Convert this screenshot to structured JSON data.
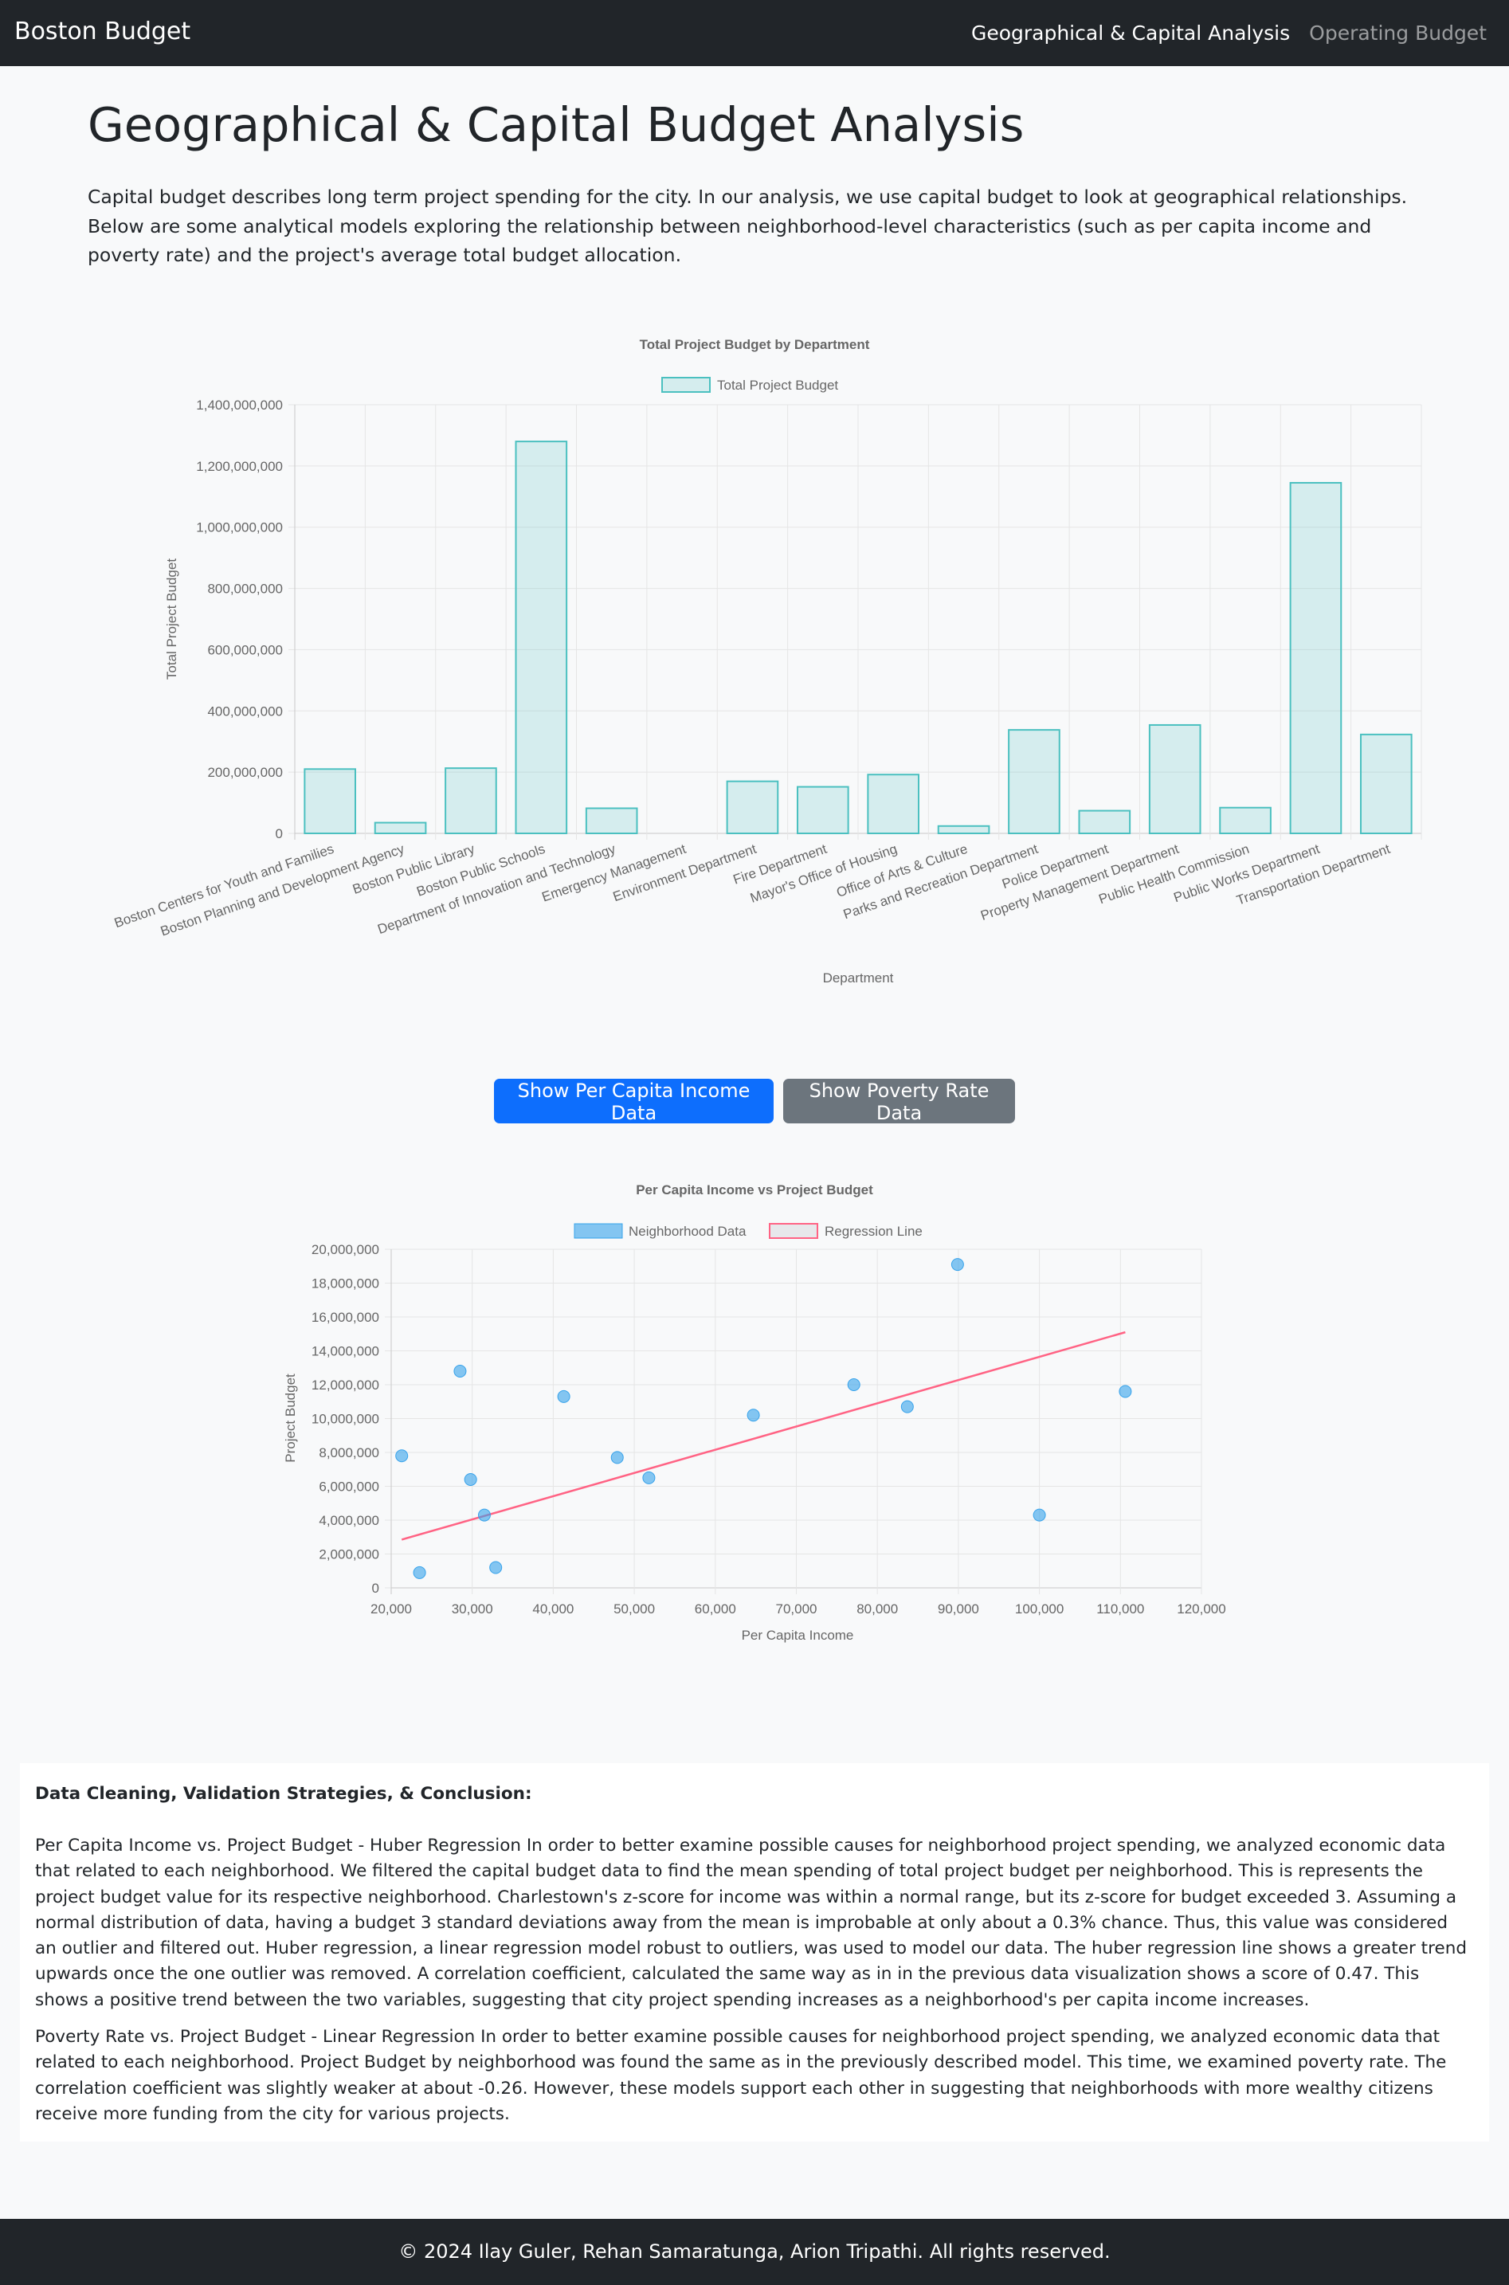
{
  "navbar": {
    "brand": "Boston Budget",
    "links": [
      {
        "label": "Geographical & Capital Analysis",
        "active": true
      },
      {
        "label": "Operating Budget",
        "active": false
      }
    ]
  },
  "page": {
    "title": "Geographical & Capital Budget Analysis",
    "intro": "Capital budget describes long term project spending for the city. In our analysis, we use capital budget to look at geographical relationships. Below are some analytical models exploring the relationship between neighborhood-level characteristics (such as per capita income and poverty rate) and the project's average total budget allocation."
  },
  "buttons": {
    "income": "Show Per Capita Income Data",
    "poverty": "Show Poverty Rate Data"
  },
  "chart_data": [
    {
      "type": "bar",
      "title": "Total Project Budget by Department",
      "xlabel": "Department",
      "ylabel": "Total Project Budget",
      "legend": "Total Project Budget",
      "legend_position": "top",
      "ylim": [
        0,
        1400000000
      ],
      "yticks": [
        "0",
        "200,000,000",
        "400,000,000",
        "600,000,000",
        "800,000,000",
        "1,000,000,000",
        "1,200,000,000",
        "1,400,000,000"
      ],
      "grid": true,
      "colors": {
        "fill": "rgba(75,192,192,0.2)",
        "stroke": "#4bc0c0"
      },
      "categories": [
        "Boston Centers for Youth and Families",
        "Boston Planning and Development Agency",
        "Boston Public Library",
        "Boston Public Schools",
        "Department of Innovation and Technology",
        "Emergency Management",
        "Environment Department",
        "Fire Department",
        "Mayor's Office of Housing",
        "Office of Arts & Culture",
        "Parks and Recreation Department",
        "Police Department",
        "Property Management Department",
        "Public Health Commission",
        "Public Works Department",
        "Transportation Department"
      ],
      "values": [
        210000000,
        35000000,
        213000000,
        1280000000,
        82000000,
        0,
        170000000,
        152000000,
        192000000,
        24000000,
        338000000,
        74000000,
        354000000,
        84000000,
        1145000000,
        323000000
      ]
    },
    {
      "type": "scatter",
      "title": "Per Capita Income vs Project Budget",
      "xlabel": "Per Capita Income",
      "ylabel": "Project Budget",
      "legend_position": "top",
      "xlim": [
        20000,
        120000
      ],
      "ylim": [
        0,
        20000000
      ],
      "xticks": [
        "20,000",
        "30,000",
        "40,000",
        "50,000",
        "60,000",
        "70,000",
        "80,000",
        "90,000",
        "100,000",
        "110,000",
        "120,000"
      ],
      "yticks": [
        "0",
        "2,000,000",
        "4,000,000",
        "6,000,000",
        "8,000,000",
        "10,000,000",
        "12,000,000",
        "14,000,000",
        "16,000,000",
        "18,000,000",
        "20,000,000"
      ],
      "grid": true,
      "series": [
        {
          "name": "Neighborhood Data",
          "color": "#36a2eb",
          "points": [
            [
              21300,
              7800000
            ],
            [
              23500,
              900000
            ],
            [
              28500,
              12800000
            ],
            [
              29800,
              6400000
            ],
            [
              31500,
              4300000
            ],
            [
              32900,
              1200000
            ],
            [
              41300,
              11300000
            ],
            [
              47900,
              7700000
            ],
            [
              51800,
              6500000
            ],
            [
              64700,
              10200000
            ],
            [
              77100,
              12000000
            ],
            [
              83700,
              10700000
            ],
            [
              89900,
              19100000
            ],
            [
              100000,
              4300000
            ],
            [
              110600,
              11600000
            ]
          ]
        },
        {
          "name": "Regression Line",
          "color": "#ff6384",
          "points": [
            [
              21300,
              2850000
            ],
            [
              110600,
              15100000
            ]
          ]
        }
      ]
    }
  ],
  "analysis": {
    "title": "Data Cleaning, Validation Strategies, & Conclusion:",
    "paragraphs": [
      "Per Capita Income vs. Project Budget - Huber Regression In order to better examine possible causes for neighborhood project spending, we analyzed economic data that related to each neighborhood. We filtered the capital budget data to find the mean spending of total project budget per neighborhood. This is represents the project budget value for its respective neighborhood. Charlestown's z-score for income was within a normal range, but its z-score for budget exceeded 3. Assuming a normal distribution of data, having a budget 3 standard deviations away from the mean is improbable at only about a 0.3% chance. Thus, this value was considered an outlier and filtered out. Huber regression, a linear regression model robust to outliers, was used to model our data. The huber regression line shows a greater trend upwards once the one outlier was removed. A correlation coefficient, calculated the same way as in in the previous data visualization shows a score of 0.47. This shows a positive trend between the two variables, suggesting that city project spending increases as a neighborhood's per capita income increases.",
      "Poverty Rate vs. Project Budget - Linear Regression In order to better examine possible causes for neighborhood project spending, we analyzed economic data that related to each neighborhood. Project Budget by neighborhood was found the same as in the previously described model. This time, we examined poverty rate. The correlation coefficient was slightly weaker at about -0.26. However, these models support each other in suggesting that neighborhoods with more wealthy citizens receive more funding from the city for various projects."
    ]
  },
  "footer": {
    "text": "© 2024 Ilay Guler, Rehan Samaratunga, Arion Tripathi. All rights reserved."
  }
}
